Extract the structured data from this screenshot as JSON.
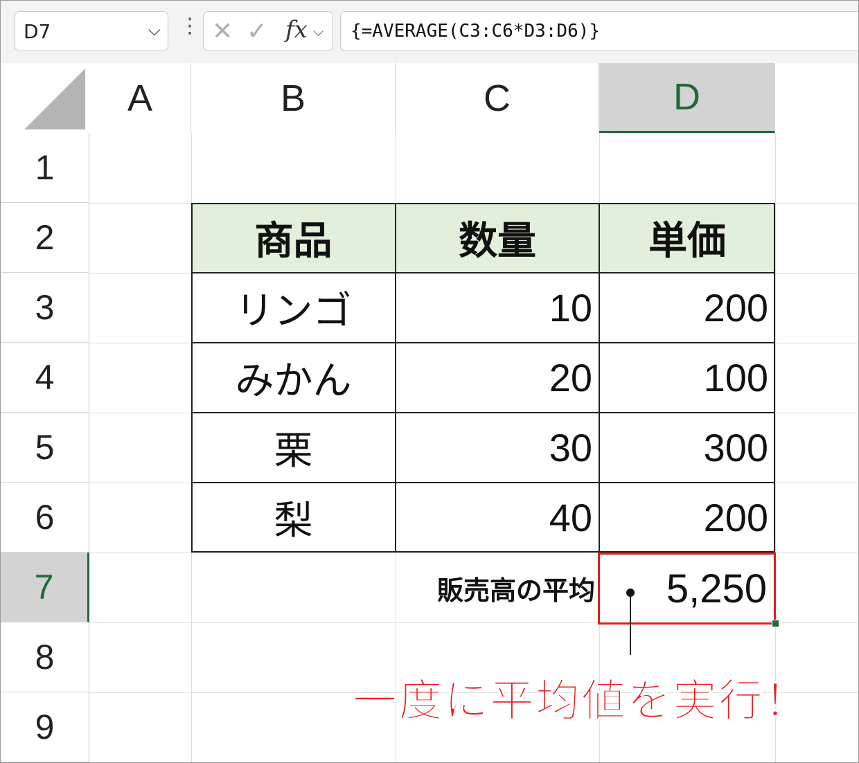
{
  "formula_bar": {
    "name_box": "D7",
    "cancel_glyph": "✕",
    "enter_glyph": "✓",
    "fx_label": "fx",
    "formula": "{=AVERAGE(C3:C6*D3:D6)}"
  },
  "columns": [
    "A",
    "B",
    "C",
    "D"
  ],
  "rows": [
    "1",
    "2",
    "3",
    "4",
    "5",
    "6",
    "7",
    "8",
    "9"
  ],
  "selected": {
    "column": "D",
    "row": "7"
  },
  "table": {
    "headers": [
      "商品",
      "数量",
      "単価"
    ],
    "rows": [
      [
        "リンゴ",
        "10",
        "200"
      ],
      [
        "みかん",
        "20",
        "100"
      ],
      [
        "栗",
        "30",
        "300"
      ],
      [
        "梨",
        "40",
        "200"
      ]
    ],
    "header_fill": "#e2efda"
  },
  "summary": {
    "label": "販売高の平均",
    "value": "5,250"
  },
  "annotation": {
    "text": "一度に平均値を実行！",
    "color": "#ee1c1c"
  },
  "colors": {
    "accent_green": "#1e6b38",
    "highlight_red": "#e81b1b"
  }
}
